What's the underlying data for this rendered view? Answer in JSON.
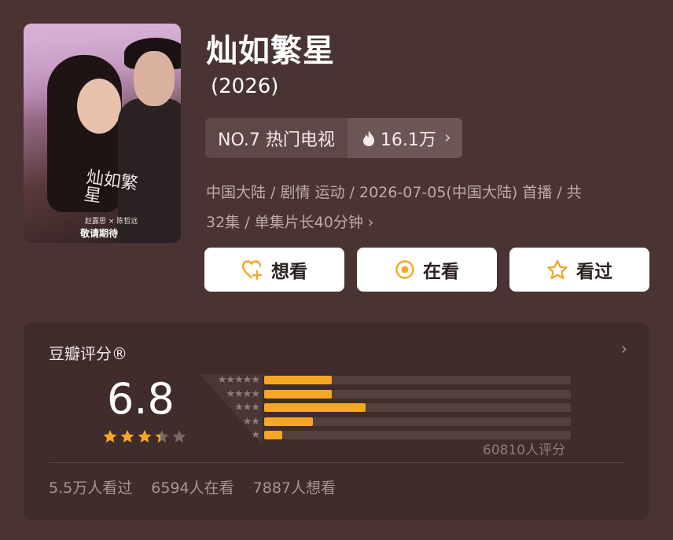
{
  "title": "灿如繁星",
  "year": "(2026)",
  "poster": {
    "calligraphy": "灿如繁星",
    "names": "赵露思 × 陈哲远",
    "badge": "敬请期待"
  },
  "ranking": {
    "rank_label": "NO.7 热门电视",
    "heat": "16.1万",
    "heat_icon": "flame-icon"
  },
  "meta": {
    "line1": "中国大陆 / 剧情 运动 / 2026-07-05(中国大陆) 首播 / 共",
    "line2": "32集 / 单集片长40分钟"
  },
  "actions": [
    {
      "label": "想看",
      "icon": "heart-plus-icon"
    },
    {
      "label": "在看",
      "icon": "target-icon"
    },
    {
      "label": "看过",
      "icon": "star-outline-icon"
    }
  ],
  "rating": {
    "title": "豆瓣评分®",
    "score": "6.8",
    "stars": 3.4,
    "raters": "60810人评分",
    "accent": "#f5a623",
    "distribution": [
      {
        "stars": 5,
        "fraction": 0.22
      },
      {
        "stars": 4,
        "fraction": 0.22
      },
      {
        "stars": 3,
        "fraction": 0.33
      },
      {
        "stars": 2,
        "fraction": 0.16
      },
      {
        "stars": 1,
        "fraction": 0.06
      }
    ]
  },
  "stats": {
    "watched": "5.5万人看过",
    "watching": "6594人在看",
    "want": "7887人想看"
  }
}
